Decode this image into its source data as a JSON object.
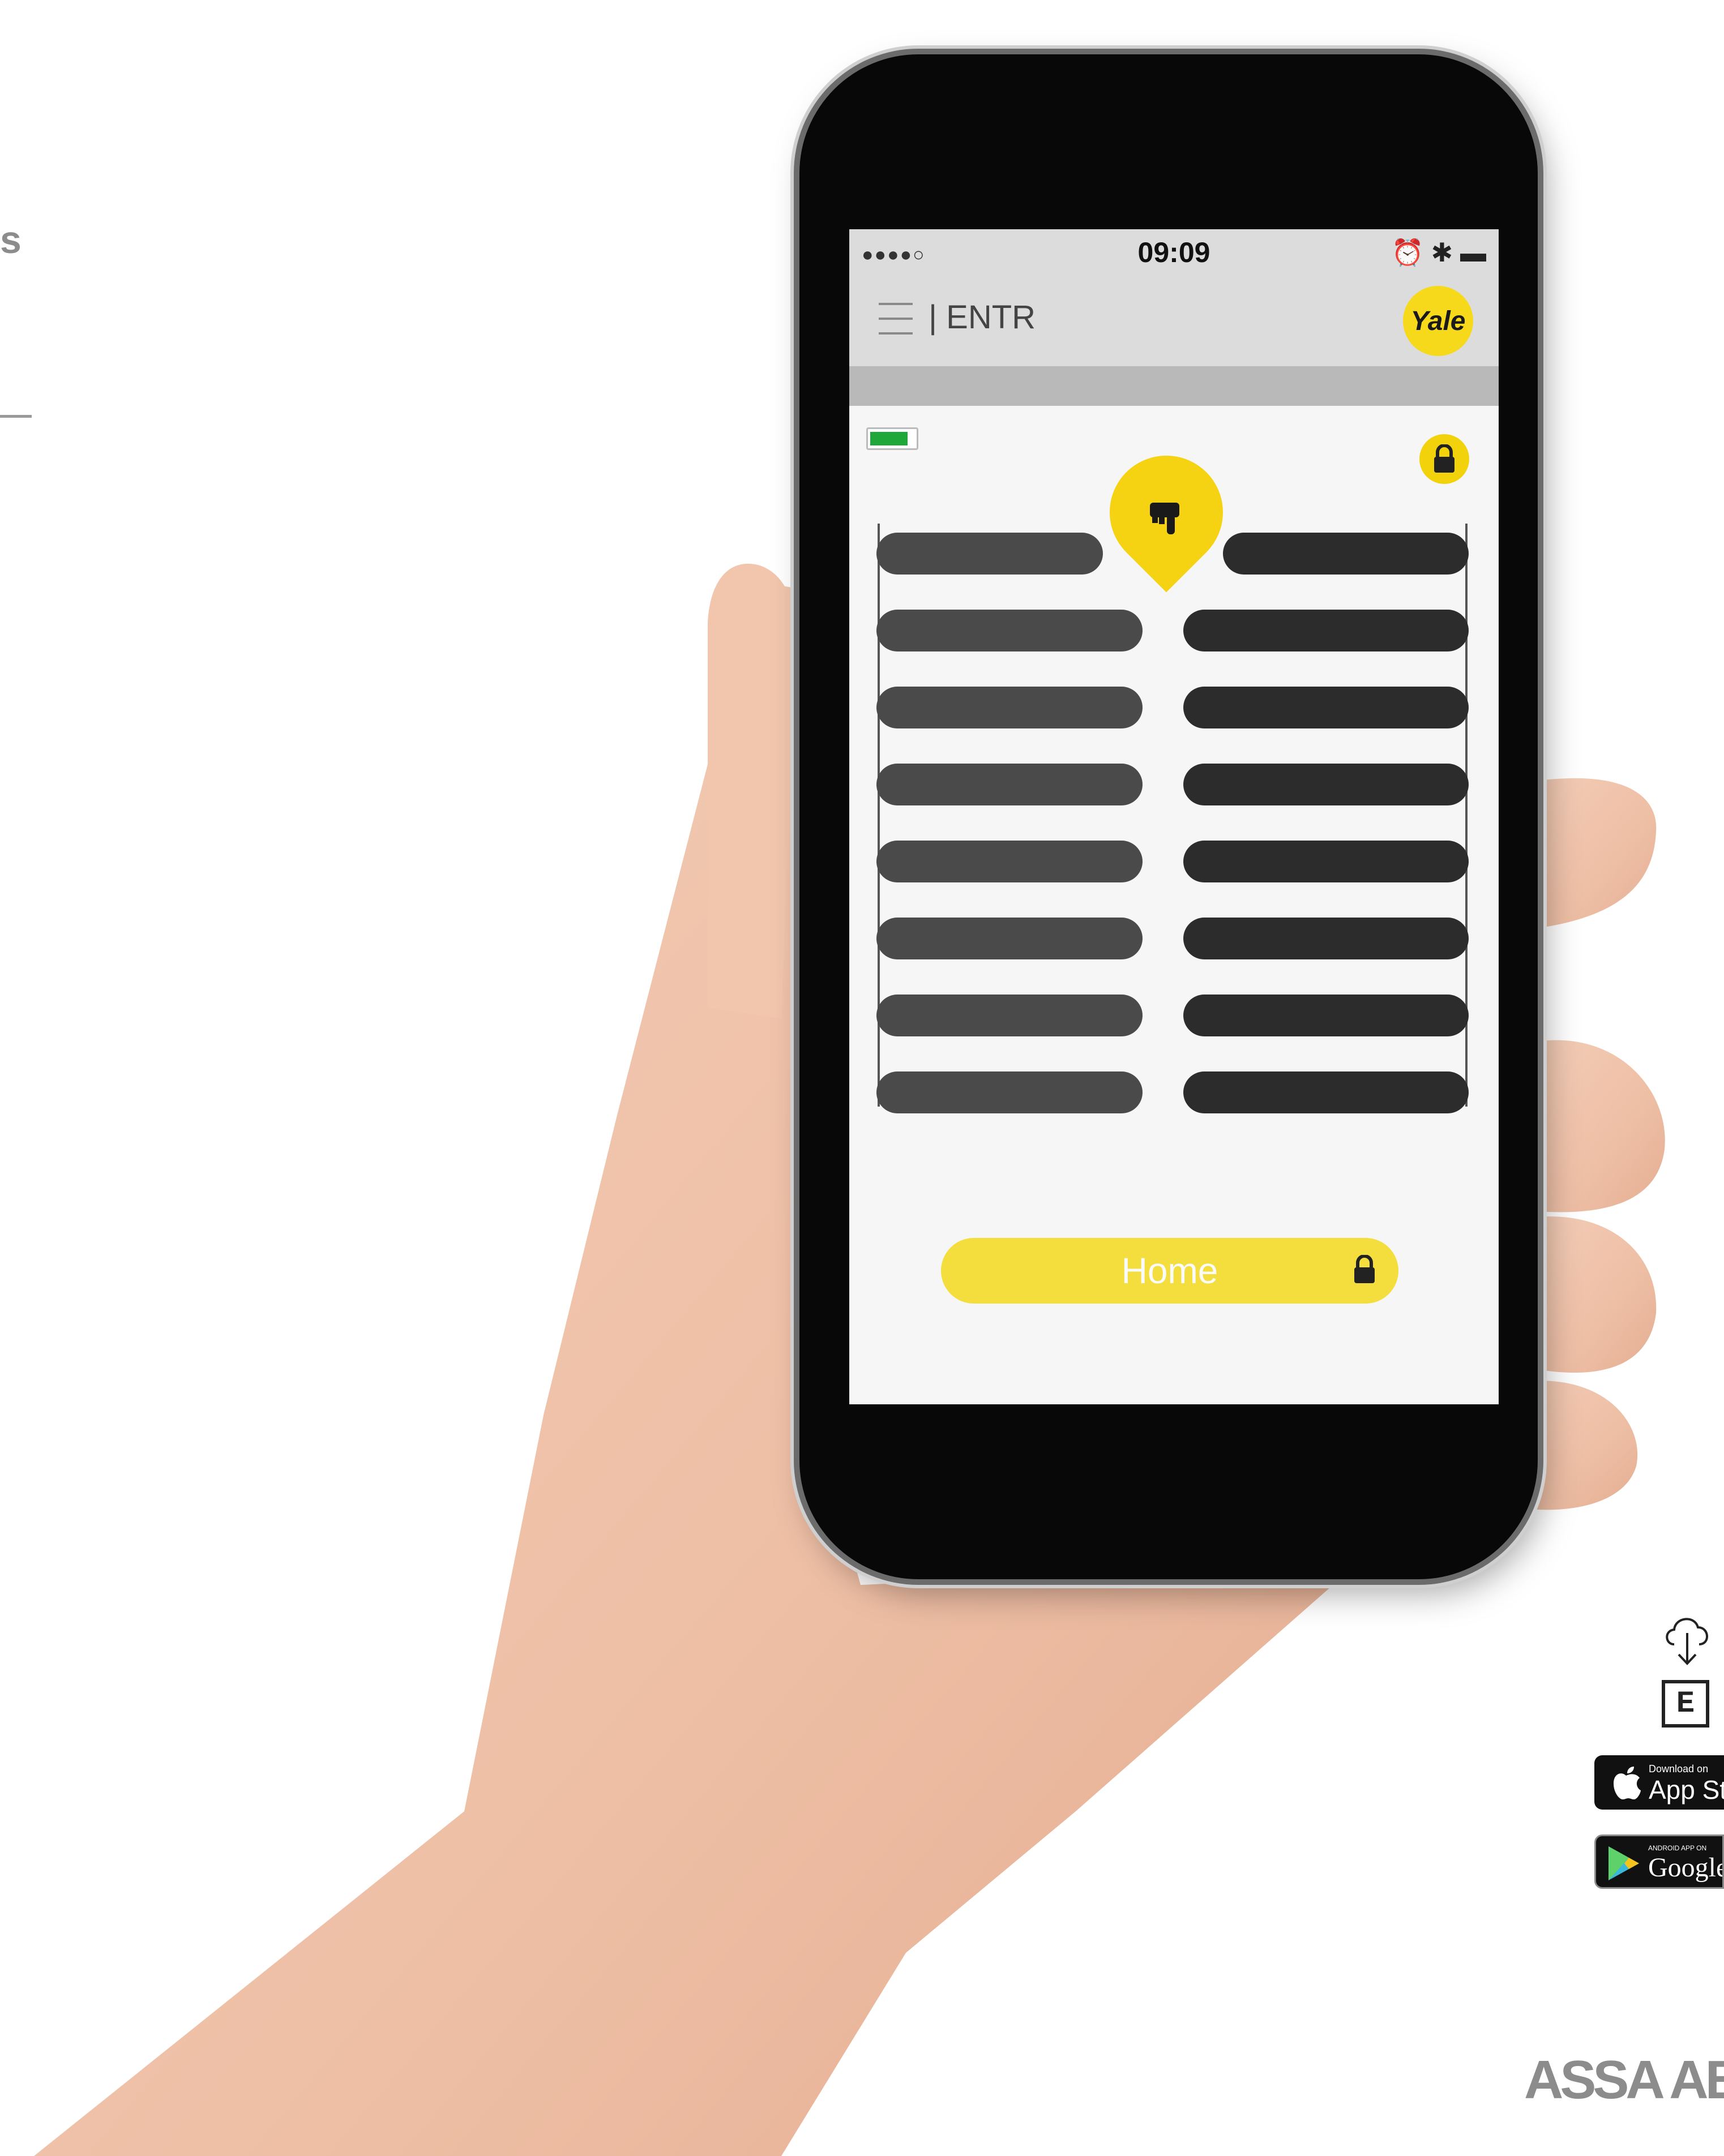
{
  "page": {
    "left_edge_text": "s",
    "corporate_logo": "ASSA AB"
  },
  "phone": {
    "status_bar": {
      "signal": "●●●●○",
      "time": "09:09",
      "system_icons": "⏰ ✱ ▬"
    },
    "app_bar": {
      "title": "| ENTR",
      "logo_text": "Yale"
    },
    "battery_level": 0.85,
    "lock_state": "locked",
    "door_slats_rows": 8,
    "home_button_label": "Home"
  },
  "downloads": {
    "app_store": {
      "small": "Download on",
      "big": "App Sto"
    },
    "google_play": {
      "small": "ANDROID APP ON",
      "big": "Google p"
    },
    "e_badge": "E"
  },
  "colors": {
    "accent_yellow": "#f5d312",
    "battery_green": "#1fa73a"
  }
}
